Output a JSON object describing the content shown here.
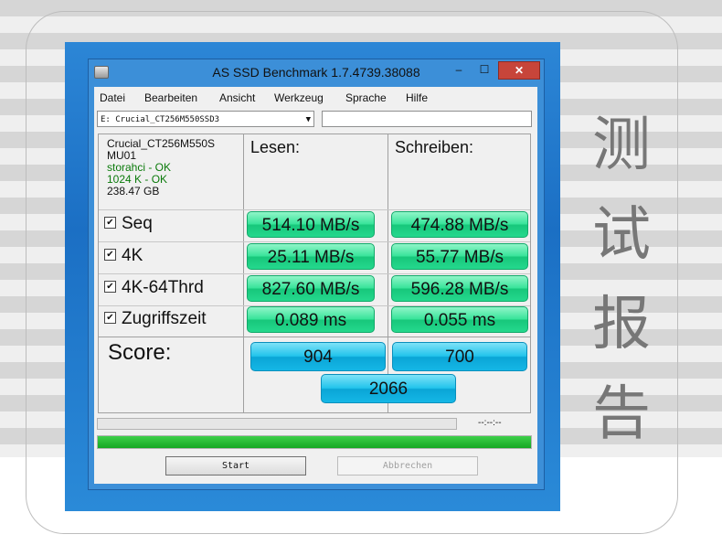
{
  "window": {
    "title": "AS SSD Benchmark 1.7.4739.38088",
    "minimize": "–",
    "maximize": "☐",
    "close": "✕"
  },
  "menu": [
    "Datei",
    "Bearbeiten",
    "Ansicht",
    "Werkzeug",
    "Sprache",
    "Hilfe"
  ],
  "drive": {
    "selected": "E: Crucial_CT256M550SSD3",
    "name": "Crucial_CT256M550S",
    "firmware": "MU01",
    "driver_status": "storahci - OK",
    "alignment_status": "1024 K - OK",
    "capacity": "238.47 GB"
  },
  "columns": {
    "read": "Lesen:",
    "write": "Schreiben:"
  },
  "tests": [
    {
      "label": "Seq",
      "checked": true,
      "read": "514.10 MB/s",
      "write": "474.88 MB/s"
    },
    {
      "label": "4K",
      "checked": true,
      "read": "25.11 MB/s",
      "write": "55.77 MB/s"
    },
    {
      "label": "4K-64Thrd",
      "checked": true,
      "read": "827.60 MB/s",
      "write": "596.28 MB/s"
    },
    {
      "label": "Zugriffszeit",
      "checked": true,
      "read": "0.089 ms",
      "write": "0.055 ms"
    }
  ],
  "score": {
    "label": "Score:",
    "read": "904",
    "write": "700",
    "total": "2066"
  },
  "status": {
    "elapsed": "--:--:--",
    "progress_fraction": 1.0
  },
  "buttons": {
    "start": "Start",
    "abort": "Abbrechen"
  },
  "side_caption": [
    "测",
    "试",
    "报",
    "告"
  ],
  "colors": {
    "result_green": "#38e49a",
    "score_blue": "#22c4ec",
    "progress_green": "#15a722"
  }
}
